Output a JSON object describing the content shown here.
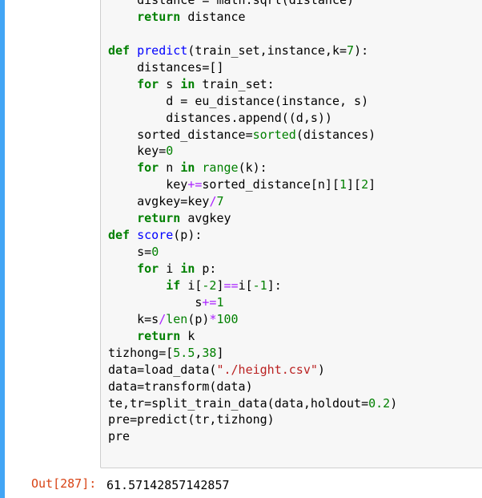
{
  "colors": {
    "cell_bar": "#42a5f5",
    "keyword": "#008000",
    "function_name": "#0000ff",
    "number": "#008000",
    "operator": "#aa22ff",
    "string": "#ba2121",
    "out_prompt": "#d84315"
  },
  "code": {
    "l1_a": "    distance = math.sqrt(distance)",
    "l2_kw": "return",
    "l2_b": " distance",
    "l4_kw": "def",
    "l4_fn": "predict",
    "l4_args_a": "(train_set,instance,k=",
    "l4_num": "7",
    "l4_args_b": "):",
    "l5": "distances=[]",
    "l6_kw": "for",
    "l6_b": " s ",
    "l6_kw2": "in",
    "l6_c": " train_set:",
    "l7_a": "d = eu_distance(instance, s)",
    "l8": "distances.append((d,s))",
    "l9_a": "sorted_distance=",
    "l9_bi": "sorted",
    "l9_b": "(distances)",
    "l10_a": "key=",
    "l10_num": "0",
    "l11_kw": "for",
    "l11_b": " n ",
    "l11_kw2": "in",
    "l11_bi": " range",
    "l11_c": "(k):",
    "l12_a": "key",
    "l12_op": "+=",
    "l12_b": "sorted_distance[n][",
    "l12_n1": "1",
    "l12_c": "][",
    "l12_n2": "2",
    "l12_d": "]",
    "l13_a": "avgkey=key",
    "l13_op": "/",
    "l13_num": "7",
    "l14_kw": "return",
    "l14_b": " avgkey",
    "l15_kw": "def",
    "l15_fn": "score",
    "l15_b": "(p):",
    "l16_a": "s=",
    "l16_num": "0",
    "l17_kw": "for",
    "l17_b": " i ",
    "l17_kw2": "in",
    "l17_c": " p:",
    "l18_kw": "if",
    "l18_a": " i[",
    "l18_n1": "-2",
    "l18_b": "]",
    "l18_op": "==",
    "l18_c": "i[",
    "l18_n2": "-1",
    "l18_d": "]:",
    "l19_a": "s",
    "l19_op": "+=",
    "l19_num": "1",
    "l20_a": "k=s",
    "l20_op1": "/",
    "l20_bi": "len",
    "l20_b": "(p)",
    "l20_op2": "*",
    "l20_num": "100",
    "l21_kw": "return",
    "l21_b": " k",
    "l22_a": "tizhong=[",
    "l22_n1": "5.5",
    "l22_b": ",",
    "l22_n2": "38",
    "l22_c": "]",
    "l23_a": "data=load_data(",
    "l23_str": "\"./height.csv\"",
    "l23_b": ")",
    "l24": "data=transform(data)",
    "l25_a": "te,tr=split_train_data(data,holdout=",
    "l25_num": "0.2",
    "l25_b": ")",
    "l26": "pre=predict(tr,tizhong)",
    "l27": "pre"
  },
  "output": {
    "prompt": "Out[287]:",
    "value": "61.57142857142857"
  }
}
